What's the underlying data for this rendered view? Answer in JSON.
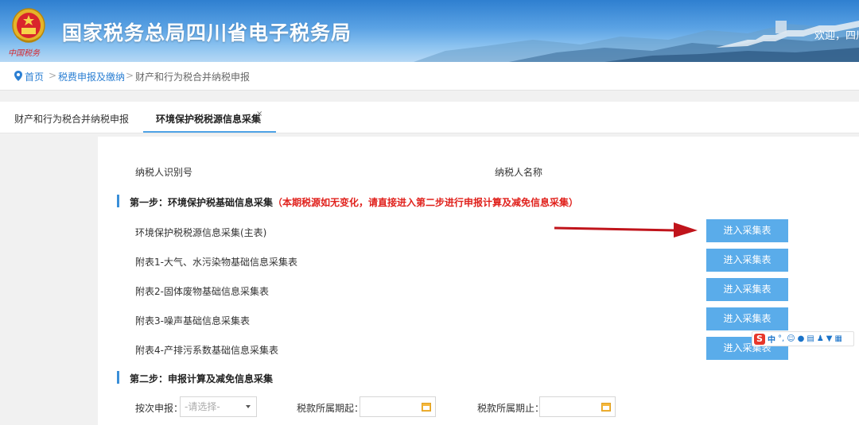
{
  "header": {
    "title": "国家税务总局四川省电子税务局",
    "brand_sub": "中国税务",
    "welcome": "欢迎，四川",
    "emblem_icon": "tax-emblem-icon"
  },
  "breadcrumb": {
    "items": [
      "首页",
      "税费申报及缴纳",
      "财产和行为税合并纳税申报"
    ],
    "separator": ">"
  },
  "tabs": [
    {
      "label": "财产和行为税合并纳税申报",
      "active": false
    },
    {
      "label": "环境保护税税源信息采集",
      "active": true,
      "close": "×"
    }
  ],
  "taxpayer": {
    "id_label": "纳税人识别号",
    "name_label": "纳税人名称"
  },
  "step1": {
    "title": "第一步：环境保护税基础信息采集",
    "note": "（本期税源如无变化，请直接进入第二步进行申报计算及减免信息采集）",
    "rows": [
      {
        "label": "环境保护税税源信息采集(主表)",
        "button": "进入采集表"
      },
      {
        "label": "附表1-大气、水污染物基础信息采集表",
        "button": "进入采集表"
      },
      {
        "label": "附表2-固体废物基础信息采集表",
        "button": "进入采集表"
      },
      {
        "label": "附表3-噪声基础信息采集表",
        "button": "进入采集表"
      },
      {
        "label": "附表4-产排污系数基础信息采集表",
        "button": "进入采集表"
      }
    ]
  },
  "step2": {
    "title": "第二步：申报计算及减免信息采集",
    "declare_label": "按次申报：",
    "declare_placeholder": "-请选择-",
    "period_start_label": "税款所属期起：",
    "period_end_label": "税款所属期止："
  },
  "ime": {
    "logo": "S",
    "mode": "中",
    "punct": "°,"
  },
  "colors": {
    "accent": "#5aacea",
    "note_red": "#e0211c",
    "arrow": "#c0141b",
    "link": "#2b7fd3"
  }
}
